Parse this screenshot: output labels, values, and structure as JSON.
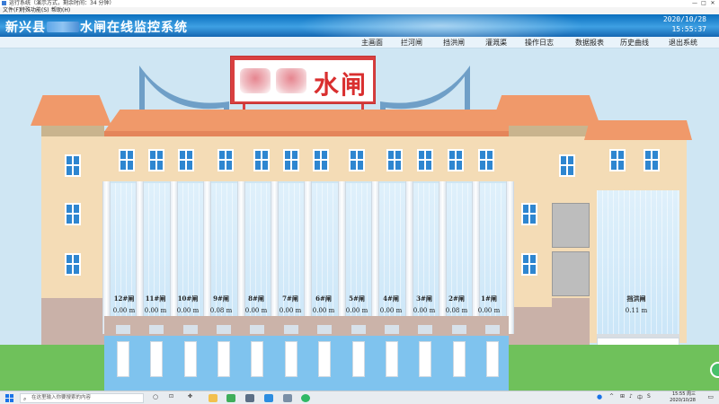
{
  "window": {
    "title": "运行系统（演示方式，剩余时间：34 分钟）",
    "menu": [
      "文件(F)",
      "特殊功能(S)",
      "帮助(H)"
    ],
    "controls": [
      "—",
      "□",
      "✕"
    ]
  },
  "header": {
    "title_prefix": "新兴县",
    "title_suffix": "水闸在线监控系统",
    "date": "2020/10/28",
    "time": "15:55:37"
  },
  "nav": [
    "主画面",
    "拦河闸",
    "挡洪闸",
    "灌溉渠",
    "操作日志",
    "数据报表",
    "历史曲线",
    "退出系统"
  ],
  "sign": {
    "text": "水闸"
  },
  "gates": [
    {
      "name": "12#闸",
      "value": "0.00 m"
    },
    {
      "name": "11#闸",
      "value": "0.00 m"
    },
    {
      "name": "10#闸",
      "value": "0.00 m"
    },
    {
      "name": "9#闸",
      "value": "0.08 m"
    },
    {
      "name": "8#闸",
      "value": "0.00 m"
    },
    {
      "name": "7#闸",
      "value": "0.00 m"
    },
    {
      "name": "6#闸",
      "value": "0.00 m"
    },
    {
      "name": "5#闸",
      "value": "0.00 m"
    },
    {
      "name": "4#闸",
      "value": "0.00 m"
    },
    {
      "name": "3#闸",
      "value": "0.00 m"
    },
    {
      "name": "2#闸",
      "value": "0.08 m"
    },
    {
      "name": "1#闸",
      "value": "0.00 m"
    }
  ],
  "flood_gate": {
    "name": "挡洪闸",
    "value": "0.11 m"
  },
  "taskbar": {
    "search_placeholder": "在这里输入你要搜索的内容",
    "tray_time": "15:55 周三",
    "tray_date": "2020/10/28",
    "ime": "中",
    "tray_extra": "S"
  },
  "colors": {
    "header_blue": "#0a6fbe",
    "roof": "#f0996a",
    "wall": "#f4dcb6",
    "sign_red": "#d94040",
    "water": "#7fc3ee",
    "grass": "#6fc15b"
  }
}
